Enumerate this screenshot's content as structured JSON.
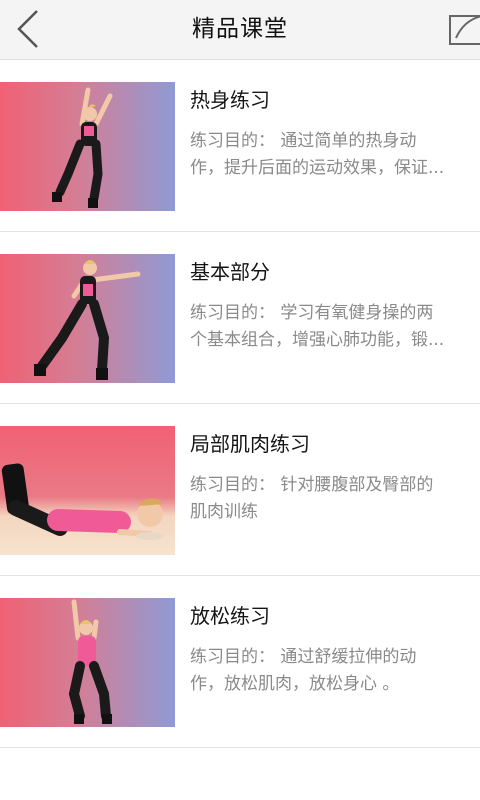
{
  "header": {
    "title": "精品课堂",
    "back_icon": "chevron-left-icon",
    "share_icon": "share-icon"
  },
  "courses": [
    {
      "title": "热身练习",
      "desc": "练习目的： 通过简单的热身动\n作，提升后面的运动效果，保证..."
    },
    {
      "title": "基本部分",
      "desc": "练习目的： 学习有氧健身操的两\n个基本组合，增强心肺功能，锻..."
    },
    {
      "title": "局部肌肉练习",
      "desc": "练习目的： 针对腰腹部及臀部的\n肌肉训练"
    },
    {
      "title": "放松练习",
      "desc": "练习目的： 通过舒缓拉伸的动\n作，放松肌肉，放松身心 。"
    }
  ],
  "colors": {
    "thumb_left": "#f06174",
    "thumb_right": "#8f9ad6",
    "outfit_pink": "#f05a96",
    "outfit_black": "#1a1a1a"
  }
}
